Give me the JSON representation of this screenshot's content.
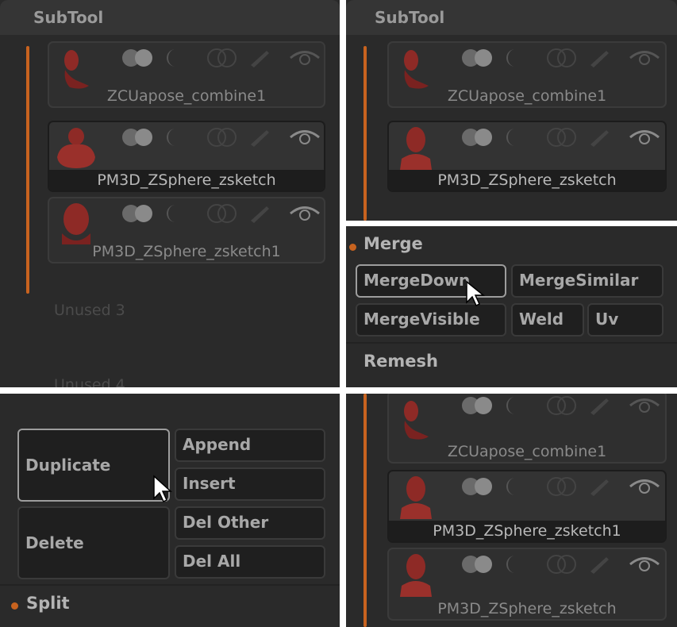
{
  "q1": {
    "title": "SubTool",
    "items": [
      {
        "label": "ZCUapose_combine1"
      },
      {
        "label": "PM3D_ZSphere_zsketch"
      },
      {
        "label": "PM3D_ZSphere_zsketch1"
      }
    ],
    "unused": [
      "Unused 3",
      "Unused 4"
    ]
  },
  "q2": {
    "title": "SubTool",
    "items": [
      {
        "label": "ZCUapose_combine1"
      },
      {
        "label": "PM3D_ZSphere_zsketch"
      }
    ]
  },
  "q3": {
    "section": "Merge",
    "buttons": [
      "MergeDown",
      "MergeSimilar",
      "MergeVisible",
      "Weld",
      "Uv"
    ],
    "section2": "Remesh"
  },
  "q4": {
    "buttons": [
      "Duplicate",
      "Append",
      "Insert",
      "Delete",
      "Del Other",
      "Del All"
    ],
    "section": "Split"
  },
  "q5": {
    "items": [
      {
        "label": "ZCUapose_combine1"
      },
      {
        "label": "PM3D_ZSphere_zsketch1"
      },
      {
        "label": "PM3D_ZSphere_zsketch"
      }
    ]
  },
  "colors": {
    "accent": "#c8631f",
    "panel": "#2a2a2a",
    "bust": "#8e2a26"
  }
}
